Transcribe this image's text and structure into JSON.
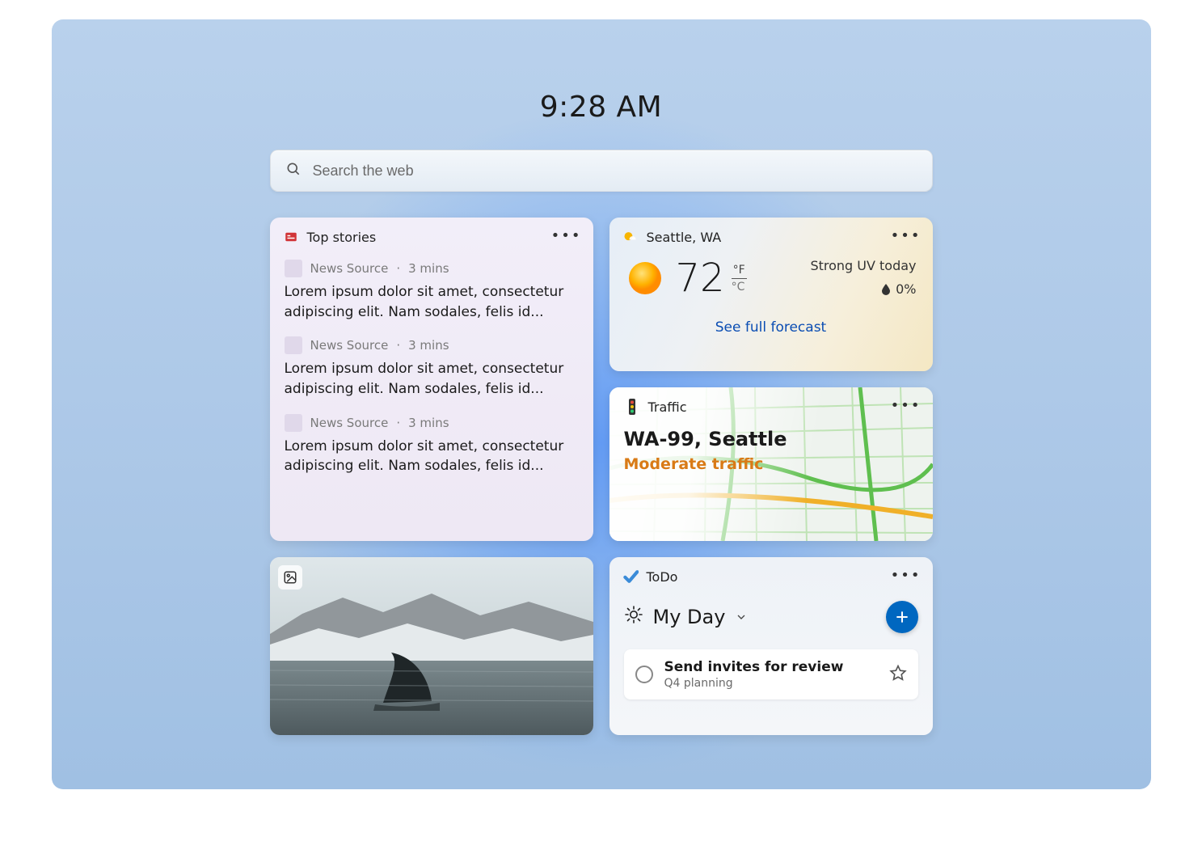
{
  "clock": "9:28 AM",
  "search": {
    "placeholder": "Search the web"
  },
  "widgets": {
    "news": {
      "title": "Top stories",
      "items": [
        {
          "source": "News Source",
          "age": "3 mins",
          "headline": "Lorem ipsum dolor sit amet, consectetur adipiscing elit. Nam sodales, felis id..."
        },
        {
          "source": "News Source",
          "age": "3 mins",
          "headline": "Lorem ipsum dolor sit amet, consectetur adipiscing elit. Nam sodales, felis id..."
        },
        {
          "source": "News Source",
          "age": "3 mins",
          "headline": "Lorem ipsum dolor sit amet, consectetur adipiscing elit. Nam sodales, felis id..."
        }
      ]
    },
    "weather": {
      "location": "Seattle, WA",
      "temp": "72",
      "unit_primary": "°F",
      "unit_secondary": "°C",
      "note": "Strong UV today",
      "precip": "0%",
      "link": "See full forecast"
    },
    "traffic": {
      "title": "Traffic",
      "route": "WA-99, Seattle",
      "status": "Moderate traffic",
      "status_color": "#d97a16"
    },
    "todo": {
      "title": "ToDo",
      "list_name": "My Day",
      "tasks": [
        {
          "title": "Send invites for review",
          "subtitle": "Q4 planning"
        }
      ]
    }
  }
}
